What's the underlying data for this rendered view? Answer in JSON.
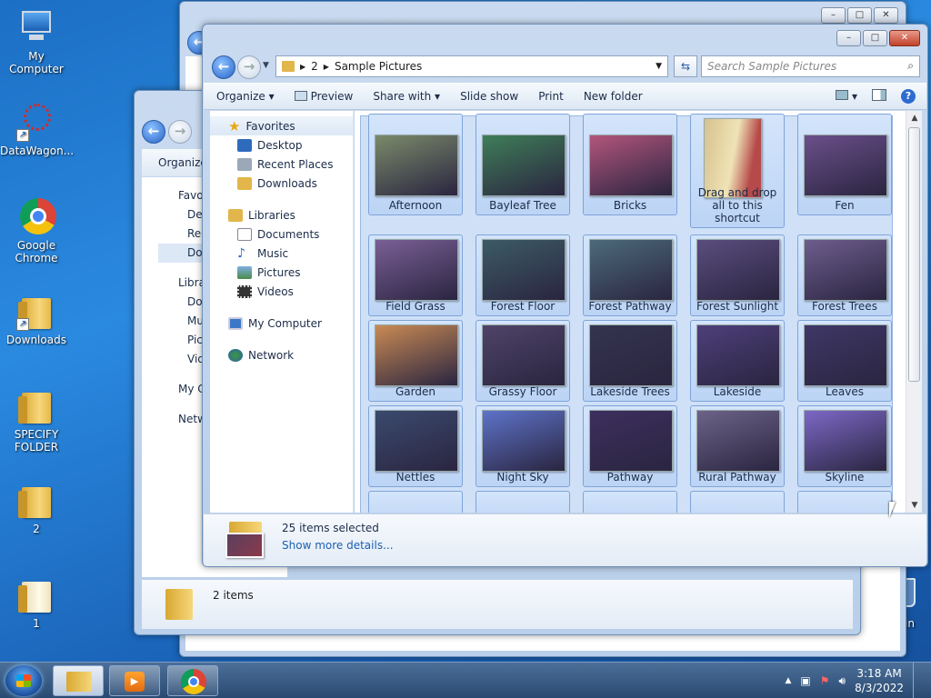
{
  "desktop": {
    "icons": [
      {
        "label": "My Computer"
      },
      {
        "label": "DataWagon..."
      },
      {
        "label": "Google Chrome"
      },
      {
        "label": "Downloads"
      },
      {
        "label": "SPECIFY FOLDER"
      },
      {
        "label": "2"
      },
      {
        "label": "1"
      },
      {
        "label": "cle Bin"
      }
    ]
  },
  "bg_window": {
    "organize": "Organize",
    "nav": [
      "Favo",
      "Des",
      "Rec",
      "Dow",
      "Libra",
      "Do",
      "Mu",
      "Pic",
      "Vid",
      "My C",
      "Netw"
    ],
    "status": "2 items"
  },
  "explorer": {
    "breadcrumb": [
      "2",
      "Sample Pictures"
    ],
    "search_placeholder": "Search Sample Pictures",
    "toolbar": {
      "organize": "Organize",
      "preview": "Preview",
      "share_with": "Share with",
      "slide_show": "Slide show",
      "print": "Print",
      "new_folder": "New folder"
    },
    "nav": {
      "favorites": "Favorites",
      "desktop": "Desktop",
      "recent_places": "Recent Places",
      "downloads": "Downloads",
      "libraries": "Libraries",
      "documents": "Documents",
      "music": "Music",
      "pictures": "Pictures",
      "videos": "Videos",
      "my_computer": "My Computer",
      "network": "Network"
    },
    "items": [
      {
        "label": "Afternoon",
        "color": "#7a8a6a"
      },
      {
        "label": "Bayleaf Tree",
        "color": "#3f7d58"
      },
      {
        "label": "Bricks",
        "color": "#b2557c"
      },
      {
        "label": "Drag and drop all to this shortcut",
        "color": "#c9a15a"
      },
      {
        "label": "Fen",
        "color": "#6b4f8a"
      },
      {
        "label": "Field Grass",
        "color": "#7a5f96"
      },
      {
        "label": "Forest Floor",
        "color": "#3c5b66"
      },
      {
        "label": "Forest Pathway",
        "color": "#4c6a7a"
      },
      {
        "label": "Forest Sunlight",
        "color": "#5a4d7e"
      },
      {
        "label": "Forest Trees",
        "color": "#6d5d8d"
      },
      {
        "label": "Garden",
        "color": "#c98a54"
      },
      {
        "label": "Grassy Floor",
        "color": "#4f4468"
      },
      {
        "label": "Lakeside Trees",
        "color": "#34344e"
      },
      {
        "label": "Lakeside",
        "color": "#4d3f7a"
      },
      {
        "label": "Leaves",
        "color": "#3f3766"
      },
      {
        "label": "Nettles",
        "color": "#3b4a6e"
      },
      {
        "label": "Night Sky",
        "color": "#5d73c9"
      },
      {
        "label": "Pathway",
        "color": "#3d2f5e"
      },
      {
        "label": "Rural Pathway",
        "color": "#6c6388"
      },
      {
        "label": "Skyline",
        "color": "#7c68c6"
      }
    ],
    "details": {
      "count": "25 items selected",
      "more": "Show more details..."
    }
  },
  "taskbar": {
    "time": "3:18 AM",
    "date": "8/3/2022"
  }
}
